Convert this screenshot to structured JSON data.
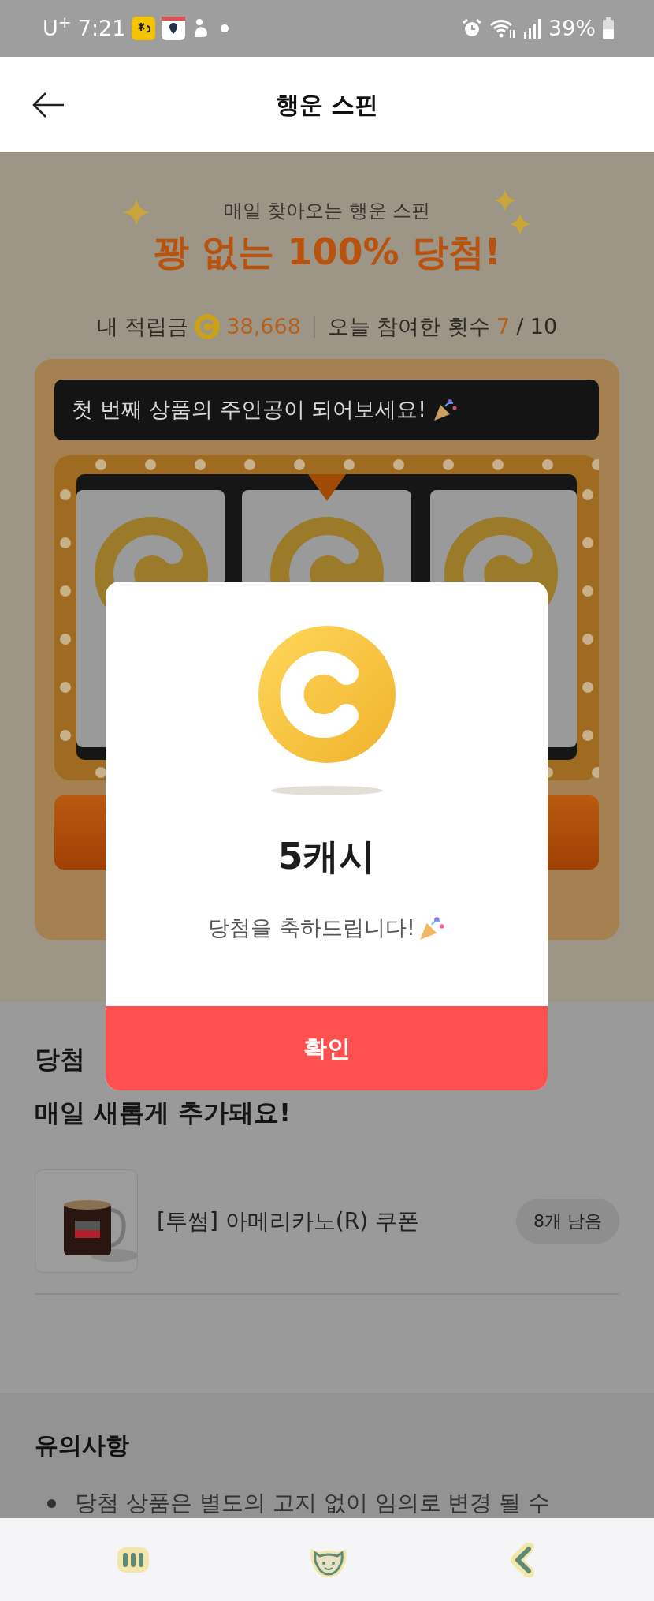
{
  "status_bar": {
    "carrier": "U$^{+}$",
    "time": "7:21",
    "battery": "39%"
  },
  "header": {
    "title": "행운 스핀"
  },
  "hero": {
    "subtitle": "매일 찾아오는 행운 스핀",
    "headline": "꽝 없는 100% 당첨!",
    "balance_label": "내 적립금",
    "balance": "38,668",
    "count_label": "오늘 참여한 횟수",
    "count_done": "7",
    "count_total": "/ 10"
  },
  "machine": {
    "message": "첫 번째 상품의 주인공이 되어보세요!"
  },
  "prizes": {
    "heading_lines": [
      "당첨",
      "매일 새롭게 추가돼요!"
    ],
    "items": [
      {
        "name": "[투썸] 아메리카노(R) 쿠폰",
        "remaining": "8개 남음"
      }
    ]
  },
  "notice": {
    "title": "유의사항",
    "items": [
      "당첨 상품은 별도의 고지 없이 임의로 변경 될 수"
    ]
  },
  "dialog": {
    "amount": "5캐시",
    "message": "당첨을 축하드립니다!",
    "confirm": "확인"
  }
}
